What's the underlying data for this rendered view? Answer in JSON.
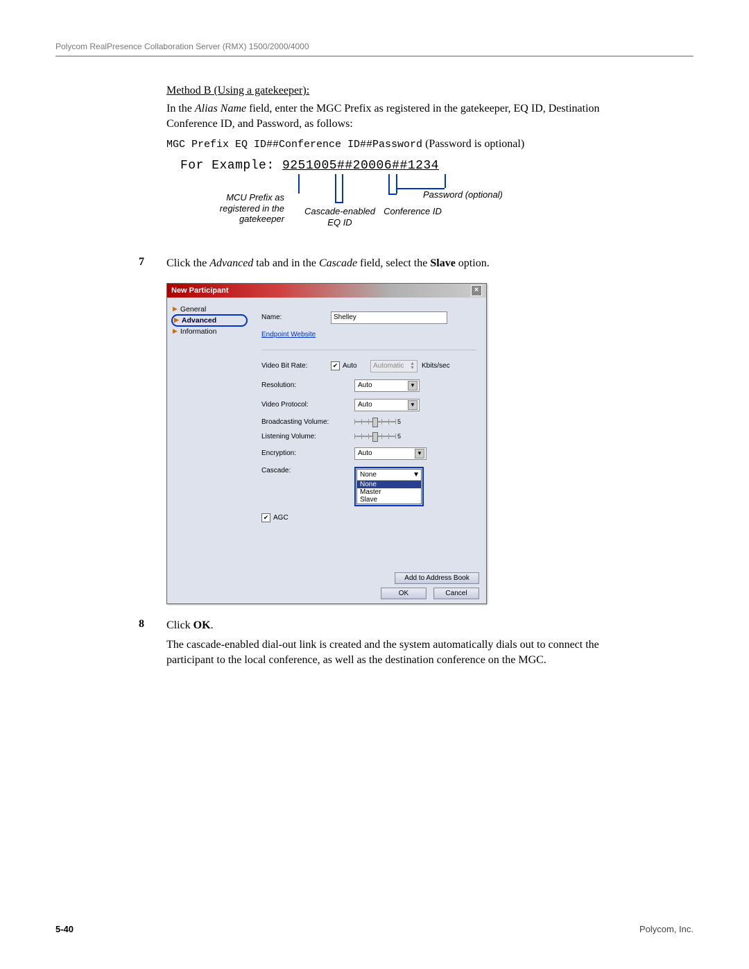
{
  "header": "Polycom RealPresence Collaboration Server (RMX) 1500/2000/4000",
  "method": {
    "title": "Method B (Using a gatekeeper):",
    "p1_pre": "In the ",
    "p1_italic": "Alias Name",
    "p1_post": " field, enter the MGC Prefix as registered in the gatekeeper, EQ ID, Destination Conference ID, and Password, as follows:",
    "syntax": "MGC Prefix EQ ID##Conference ID##Password",
    "syntax_note": "(Password is optional)"
  },
  "example": {
    "label": "For Example: ",
    "value": "9251005##20006##1234",
    "anno_mcu": "MCU Prefix as registered in the gatekeeper",
    "anno_eq": "Cascade-enabled EQ ID",
    "anno_conf": "Conference ID",
    "anno_pw": "Password (optional)"
  },
  "step7": {
    "num": "7",
    "pre": "Click the ",
    "i1": "Advanced",
    "mid": " tab and in the ",
    "i2": "Cascade",
    "post1": " field, select the ",
    "b": "Slave",
    "post2": " option."
  },
  "dialog": {
    "title": "New Participant",
    "nav": {
      "general": "General",
      "advanced": "Advanced",
      "information": "Information"
    },
    "form": {
      "name_label": "Name:",
      "name_value": "Shelley",
      "endpoint_link": "Endpoint Website",
      "vbr_label": "Video Bit Rate:",
      "auto_label": "Auto",
      "vbr_value": "Automatic",
      "vbr_unit": "Kbits/sec",
      "res_label": "Resolution:",
      "res_value": "Auto",
      "vp_label": "Video Protocol:",
      "vp_value": "Auto",
      "bv_label": "Broadcasting Volume:",
      "bv_value": "5",
      "lv_label": "Listening Volume:",
      "lv_value": "5",
      "enc_label": "Encryption:",
      "enc_value": "Auto",
      "cas_label": "Cascade:",
      "cas_selected": "None",
      "cas_options": {
        "a": "None",
        "b": "Master",
        "c": "Slave"
      },
      "agc_label": "AGC"
    },
    "buttons": {
      "add": "Add to Address Book",
      "ok": "OK",
      "cancel": "Cancel"
    }
  },
  "step8": {
    "num": "8",
    "line1_pre": "Click ",
    "line1_b": "OK",
    "line1_post": ".",
    "para": "The cascade-enabled dial-out link is created and the system automatically dials out to connect the participant to the local conference, as well as the destination conference on the MGC."
  },
  "footer": {
    "page": "5-40",
    "company": "Polycom, Inc."
  }
}
